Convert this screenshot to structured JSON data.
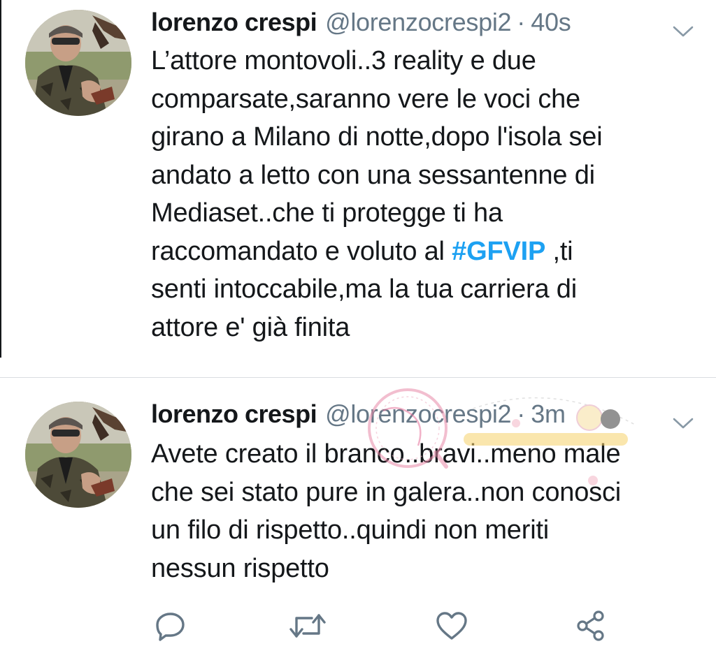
{
  "tweets": [
    {
      "display_name": "lorenzo crespi",
      "handle": "@lorenzocrespi2",
      "separator": "·",
      "time": "40s",
      "text_lines": [
        "L’attore montovoli..3 reality e due",
        "comparsate,saranno vere le voci che",
        "girano a Milano di notte,dopo l'isola sei",
        "andato a letto con una sessantenne di",
        "Mediaset..che ti protegge ti ha"
      ],
      "line6_before": "raccomandato e voluto al ",
      "hashtag": "#GFVIP",
      "line6_after": " ,ti",
      "text_lines_end": [
        "senti intoccabile,ma la tua carriera di",
        "attore e' già finita"
      ]
    },
    {
      "display_name": "lorenzo crespi",
      "handle": "@lorenzocrespi2",
      "separator": "·",
      "time": "3m",
      "text_lines": [
        "Avete creato il branco..bravi..meno male",
        "che sei stato pure in galera..non conosci",
        "un filo di rispetto..quindi non meriti",
        "nessun rispetto"
      ]
    }
  ],
  "actions": {
    "reply_icon": "reply-icon",
    "retweet_icon": "retweet-icon",
    "like_icon": "heart-icon",
    "share_icon": "share-icon"
  },
  "colors": {
    "text": "#14171a",
    "secondary": "#657786",
    "hashtag": "#1da1f2",
    "divider": "#d9dde1"
  }
}
